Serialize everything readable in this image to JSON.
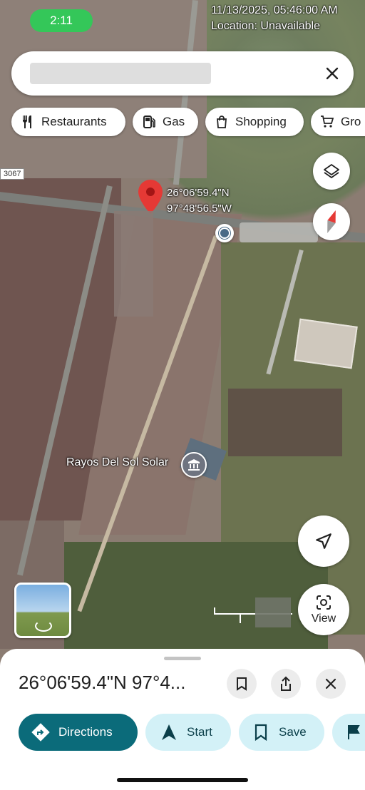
{
  "status_bar": {
    "time": "2:11",
    "timestamp": "11/13/2025, 05:46:00 AM",
    "location": "Location: Unavailable"
  },
  "search": {
    "query": ""
  },
  "chips": [
    {
      "label": "Restaurants",
      "icon": "fork-knife-icon"
    },
    {
      "label": "Gas",
      "icon": "gas-pump-icon"
    },
    {
      "label": "Shopping",
      "icon": "shopping-bag-icon"
    },
    {
      "label": "Gro",
      "icon": "cart-icon"
    }
  ],
  "map": {
    "road_label": "3067",
    "pin_lat": "26°06'59.4\"N",
    "pin_lng": "97°48'56.5\"W",
    "poi_name": "Rayos Del Sol Solar"
  },
  "buttons": {
    "view_label": "View"
  },
  "sheet": {
    "title": "26°06'59.4\"N 97°4...",
    "actions": [
      {
        "label": "Directions"
      },
      {
        "label": "Start"
      },
      {
        "label": "Save"
      }
    ]
  },
  "colors": {
    "accent": "#0b6b7a",
    "pin": "#e53935",
    "chip_bg": "#d3f1f7"
  }
}
